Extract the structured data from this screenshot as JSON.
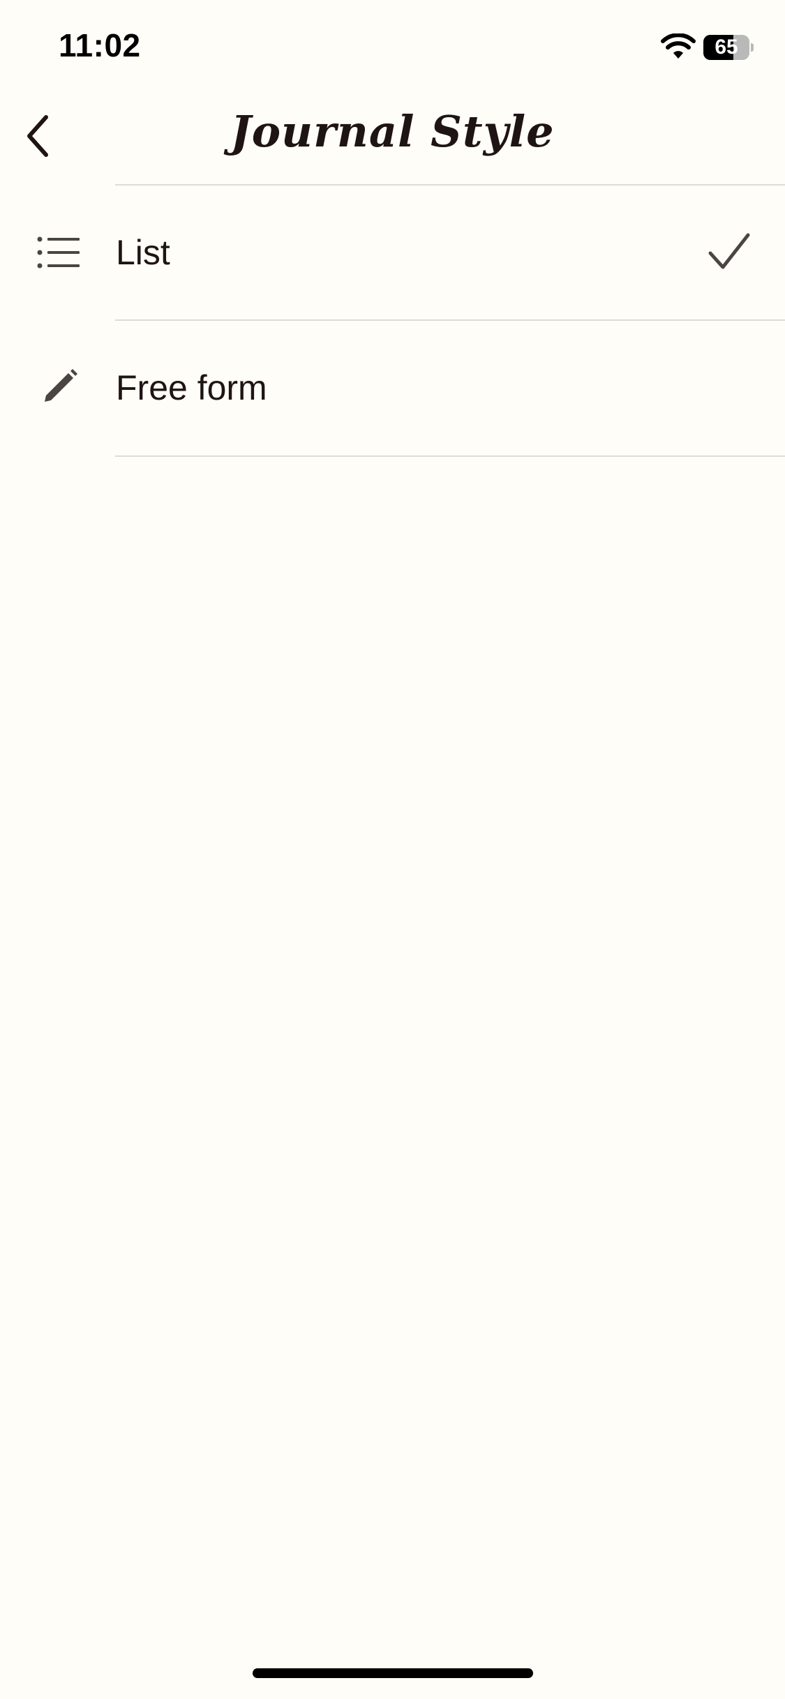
{
  "status_bar": {
    "time": "11:02",
    "battery_level": "65",
    "battery_fraction": 0.65,
    "wifi_icon": "wifi-icon"
  },
  "nav": {
    "back_icon": "chevron-left-icon",
    "title": "Journal Style"
  },
  "options": [
    {
      "label": "List",
      "icon": "list-icon",
      "selected": true
    },
    {
      "label": "Free form",
      "icon": "pencil-icon",
      "selected": false
    }
  ],
  "colors": {
    "background": "#FFFDF7",
    "text": "#1F1414",
    "icon": "#4A4443",
    "divider": "#DEDCD7"
  }
}
